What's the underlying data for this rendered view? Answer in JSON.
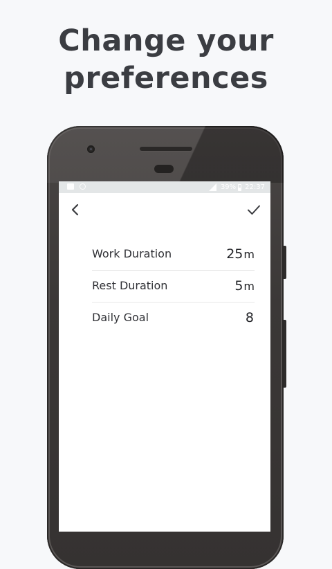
{
  "headline": {
    "line1": "Change your",
    "line2": "preferences"
  },
  "status_bar": {
    "battery_percent": "39%",
    "time": "22:37"
  },
  "toolbar": {
    "back_icon": "chevron-left-icon",
    "confirm_icon": "check-icon"
  },
  "preferences": [
    {
      "label": "Work Duration",
      "value": "25",
      "unit": "m"
    },
    {
      "label": "Rest Duration",
      "value": "5",
      "unit": "m"
    },
    {
      "label": "Daily Goal",
      "value": "8",
      "unit": ""
    }
  ],
  "colors": {
    "background": "#f7f8fa",
    "headline_text": "#3b3d42",
    "status_bar": "#e3e6e7",
    "screen": "#ffffff"
  }
}
